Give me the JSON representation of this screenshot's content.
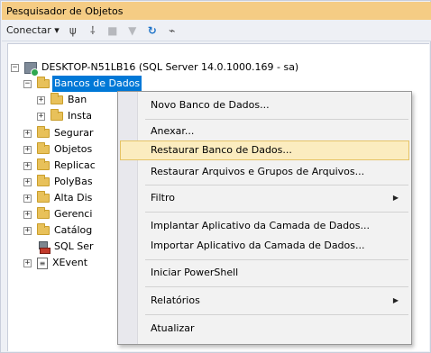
{
  "window": {
    "title": "Pesquisador de Objetos"
  },
  "toolbar": {
    "connect_label": "Conectar ▾",
    "icons": [
      "connect-plug-icon",
      "disconnect-plug-icon",
      "stop-icon",
      "filter-icon",
      "refresh-icon",
      "activity-monitor-icon"
    ]
  },
  "tree": {
    "server": "DESKTOP-N51LB16 (SQL Server 14.0.1000.169 - sa)",
    "databases": "Bancos de Dados",
    "db_child1": "Ban",
    "db_child2": "Insta",
    "seguranca": "Segurar",
    "objetos": "Objetos",
    "replicacao": "Replicac",
    "polybase": "PolyBas",
    "alta_disp": "Alta Dis",
    "gerenciamento": "Gerenci",
    "catalogo": "Catálog",
    "agent": "SQL Ser",
    "xevent": "XEvent"
  },
  "context_menu": {
    "items": {
      "novo": "Novo Banco de Dados...",
      "anexar": "Anexar...",
      "restaurar": "Restaurar Banco de Dados...",
      "restaurar_arquivos": "Restaurar Arquivos e Grupos de Arquivos...",
      "filtro": "Filtro",
      "implantar": "Implantar Aplicativo da Camada de Dados...",
      "importar": "Importar Aplicativo da Camada de Dados...",
      "powershell": "Iniciar PowerShell",
      "relatorios": "Relatórios",
      "atualizar": "Atualizar"
    },
    "highlighted": "Restaurar Banco de Dados..."
  },
  "colors": {
    "titlebar": "#f5cc84",
    "selection": "#0078d7",
    "menu_hover": "#fbecbf"
  }
}
